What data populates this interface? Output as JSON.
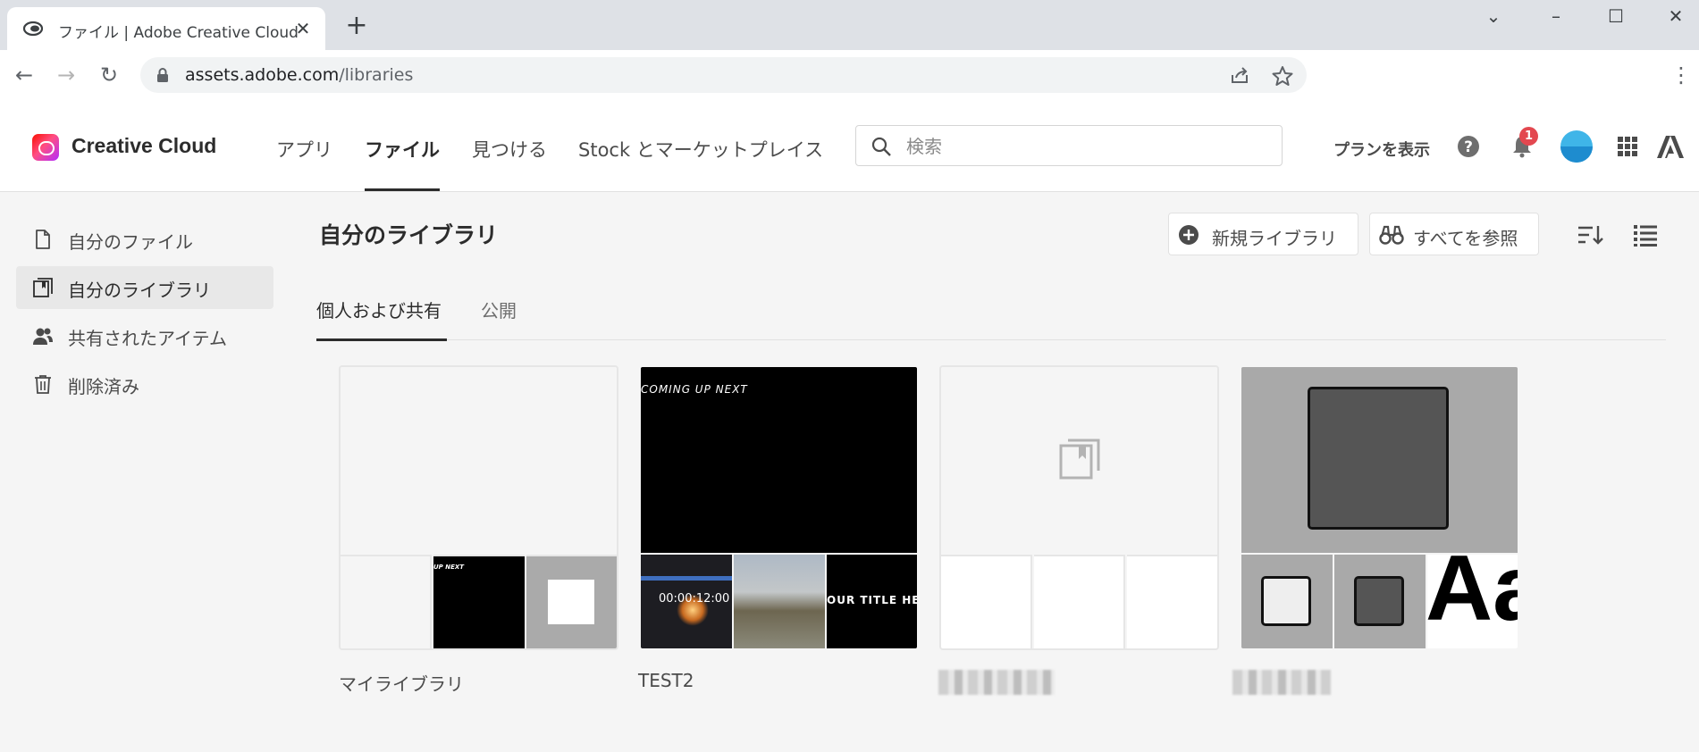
{
  "browser": {
    "tab_title": "ファイル | Adobe Creative Cloud",
    "url_host": "assets.adobe.com",
    "url_path": "/libraries"
  },
  "header": {
    "brand": "Creative Cloud",
    "nav": [
      "アプリ",
      "ファイル",
      "見つける",
      "Stock とマーケットプレイス"
    ],
    "search_placeholder": "検索",
    "plan_link": "プランを表示",
    "notification_count": "1"
  },
  "sidebar": {
    "items": [
      {
        "label": "自分のファイル",
        "icon": "file-icon"
      },
      {
        "label": "自分のライブラリ",
        "icon": "library-icon"
      },
      {
        "label": "共有されたアイテム",
        "icon": "people-icon"
      },
      {
        "label": "削除済み",
        "icon": "trash-icon"
      }
    ]
  },
  "main": {
    "title": "自分のライブラリ",
    "new_library_label": "新規ライブラリ",
    "browse_all_label": "すべてを参照",
    "tabs": [
      "個人および共有",
      "公開"
    ],
    "cards": [
      {
        "name": "マイライブラリ"
      },
      {
        "name": "TEST2"
      },
      {
        "name": ""
      },
      {
        "name": ""
      }
    ],
    "thumb_texts": {
      "coming_up": "COMING UP NEXT",
      "up_next": "UP NEXT",
      "timecode": "00:00:12:00",
      "title_text": "OUR TITLE HERE",
      "glyphs": "Aa"
    }
  },
  "colors": {
    "notification_badge": "#e34850",
    "avatar": "#3fb5e8",
    "active_underline": "#2c2c2c"
  }
}
